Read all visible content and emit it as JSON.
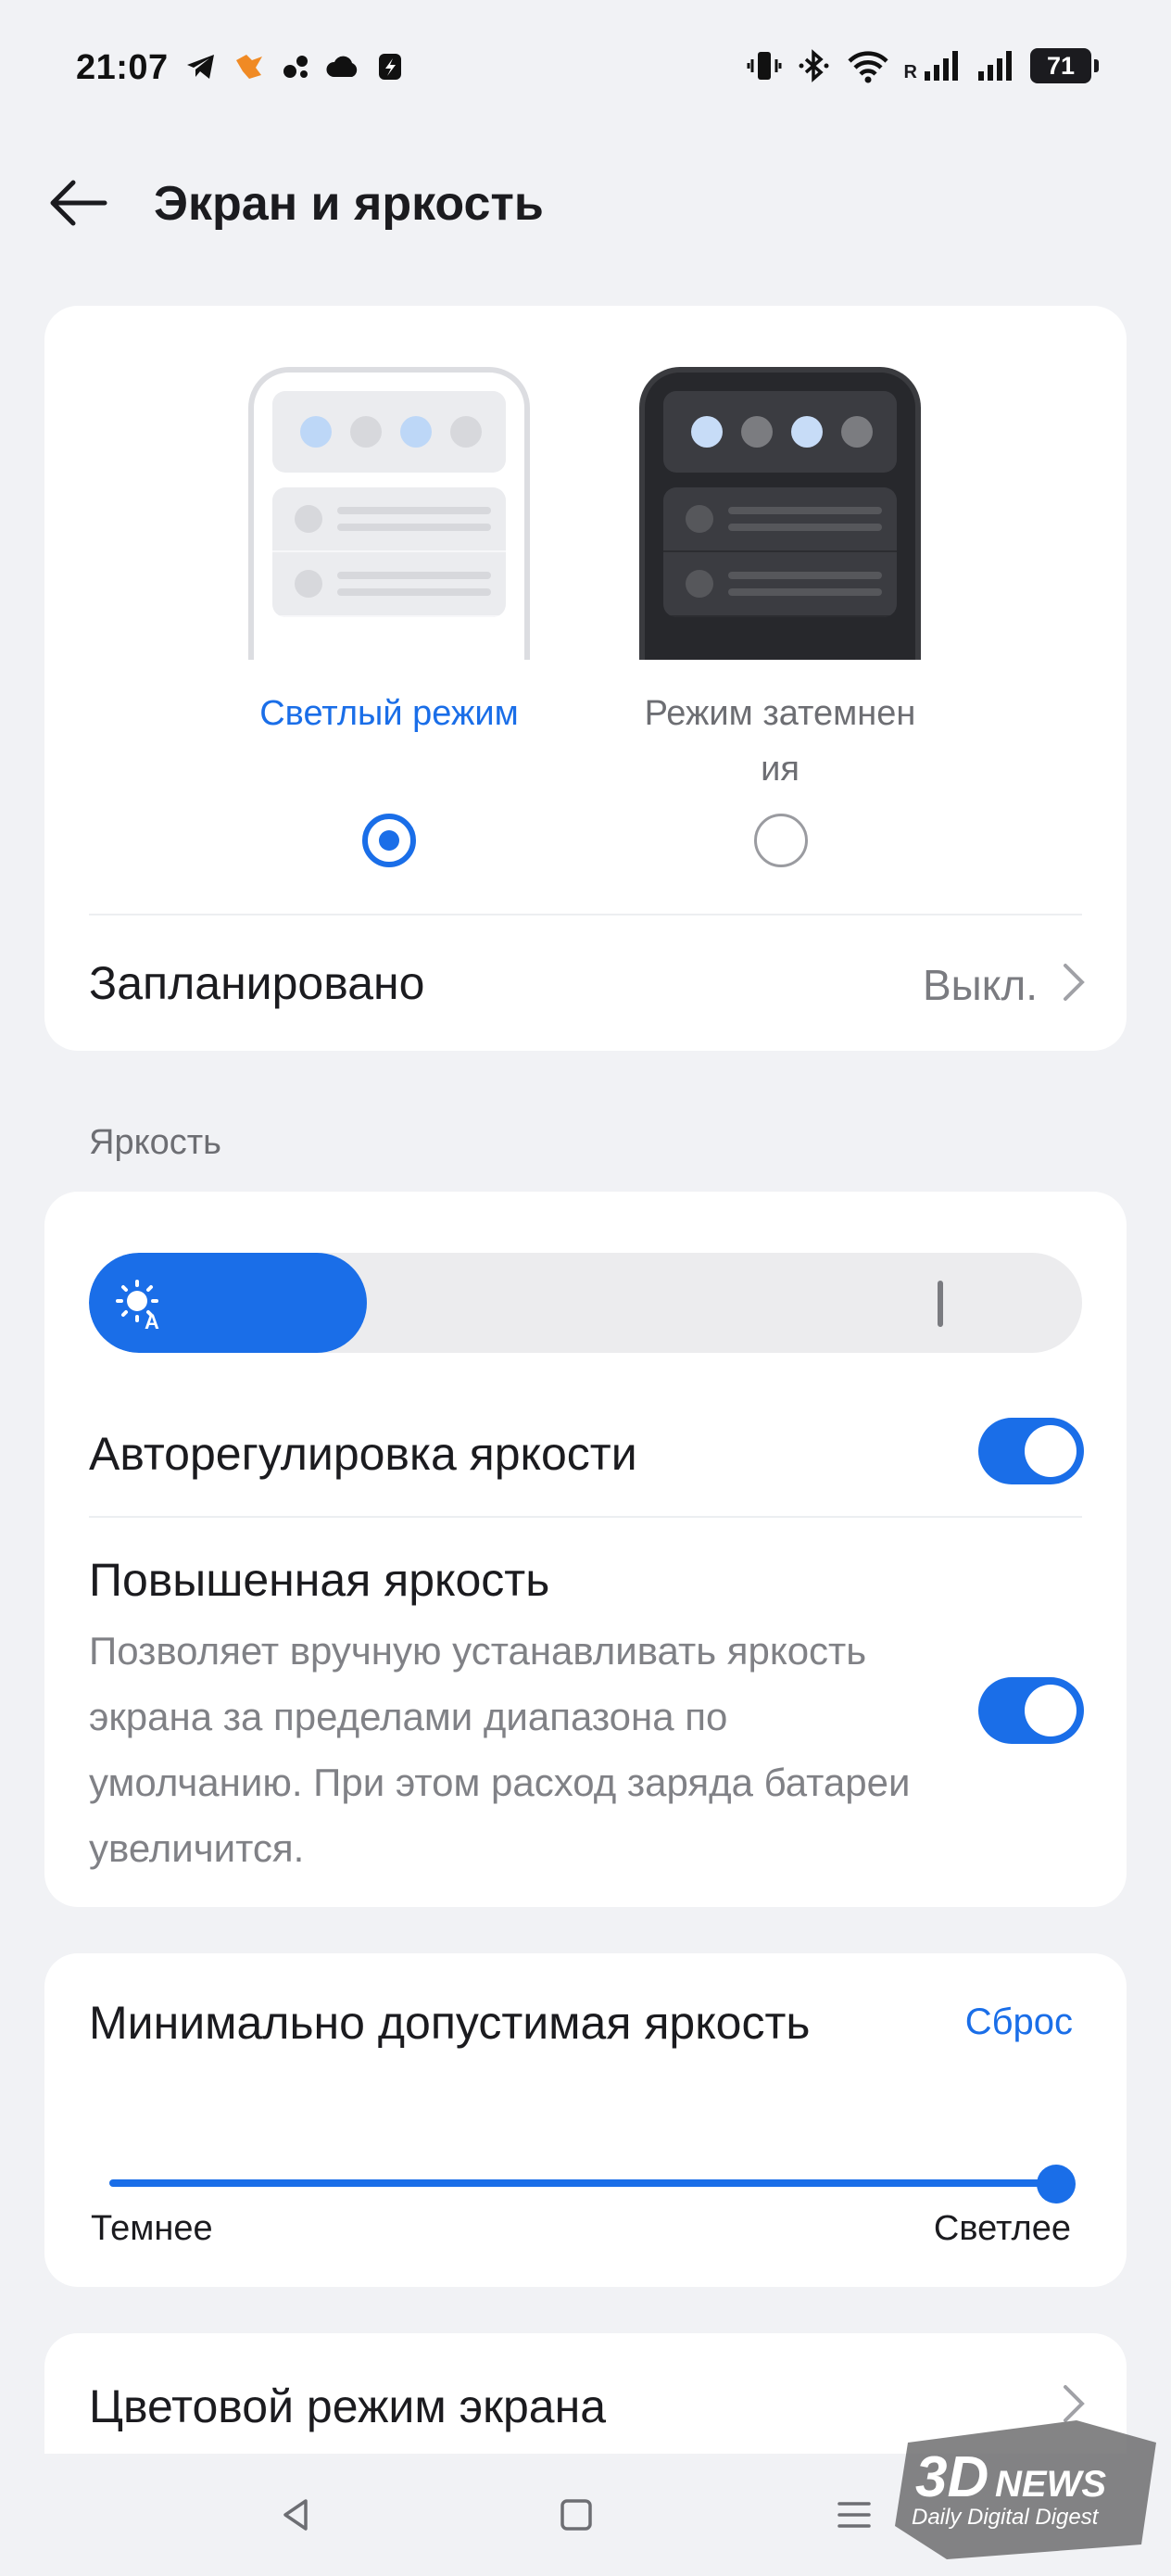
{
  "status_bar": {
    "time": "21:07",
    "left_icons": [
      "telegram-icon",
      "app-icon",
      "gear-dots-icon",
      "cloud-icon",
      "app-icon-2"
    ],
    "right_icons": [
      "vibrate-icon",
      "bluetooth-icon",
      "wifi-icon",
      "signal-icon",
      "signal-icon-2"
    ],
    "roaming": "R",
    "battery": "71"
  },
  "header": {
    "title": "Экран и яркость"
  },
  "theme": {
    "light_label": "Светлый режим",
    "dark_label_line1": "Режим затемнен",
    "dark_label_line2": "ия",
    "selected": "light",
    "scheduled_label": "Запланировано",
    "scheduled_value": "Выкл."
  },
  "brightness": {
    "section_label": "Яркость",
    "level": 0.28,
    "auto_label": "Авторегулировка яркости",
    "auto_enabled": true,
    "boost_label": "Повышенная яркость",
    "boost_desc": "Позволяет вручную устанавливать яркость экрана за пределами диапазона по умолчанию. При этом расход заряда батареи увеличится.",
    "boost_enabled": true
  },
  "min_brightness": {
    "title": "Минимально допустимая яркость",
    "reset_label": "Сброс",
    "value": 1.0,
    "low_label": "Темнее",
    "high_label": "Светлее"
  },
  "color_mode": {
    "label": "Цветовой режим экрана"
  },
  "navbar": {
    "buttons": [
      "back-triangle-icon",
      "home-square-icon",
      "menu-lines-icon"
    ]
  },
  "watermark": {
    "line1": "3DNEWS",
    "line2": "Daily Digital Digest"
  },
  "colors": {
    "accent": "#1a6ee8",
    "background": "#f1f2f5",
    "card": "#ffffff"
  }
}
